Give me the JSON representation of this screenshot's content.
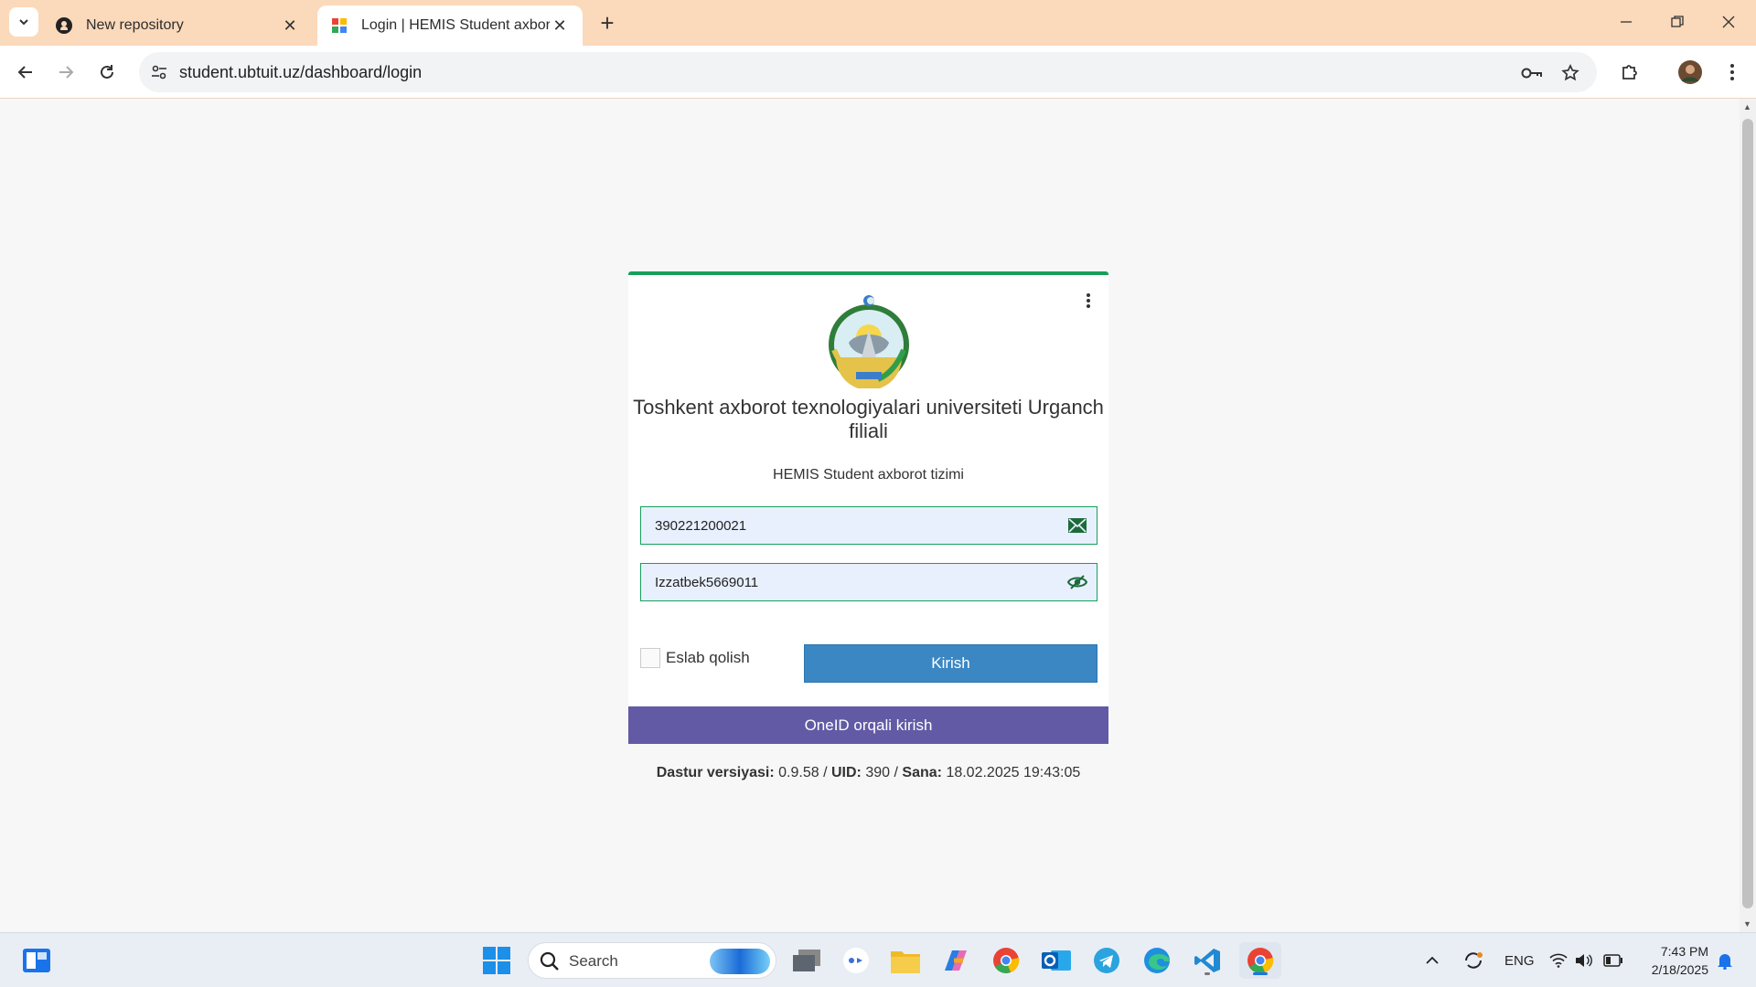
{
  "browser": {
    "tabs": [
      {
        "title": "New repository",
        "favicon": "github-icon"
      },
      {
        "title": "Login | HEMIS Student axborot",
        "favicon": "hemis-icon",
        "active": true
      }
    ],
    "url": "student.ubtuit.uz/dashboard/login"
  },
  "page": {
    "university_name": "Toshkent axborot texnologiyalari universiteti Urganch filiali",
    "system_name": "HEMIS Student axborot tizimi",
    "login_value": "390221200021",
    "password_value": "Izzatbek5669011",
    "remember_label": "Eslab qolish",
    "login_button": "Kirish",
    "oneid_button": "OneID orqali kirish",
    "footer": {
      "version_label": "Dastur versiyasi:",
      "version_value": "0.9.58",
      "uid_label": "UID:",
      "uid_value": "390",
      "date_label": "Sana:",
      "date_value": "18.02.2025 19:43:05",
      "separator": "/"
    }
  },
  "taskbar": {
    "search_placeholder": "Search",
    "language": "ENG",
    "time": "7:43 PM",
    "date": "2/18/2025"
  },
  "colors": {
    "accent_green": "#16a05a",
    "login_button": "#3a87c3",
    "oneid_button": "#625aa5",
    "tab_bar": "#fbd9bb"
  }
}
